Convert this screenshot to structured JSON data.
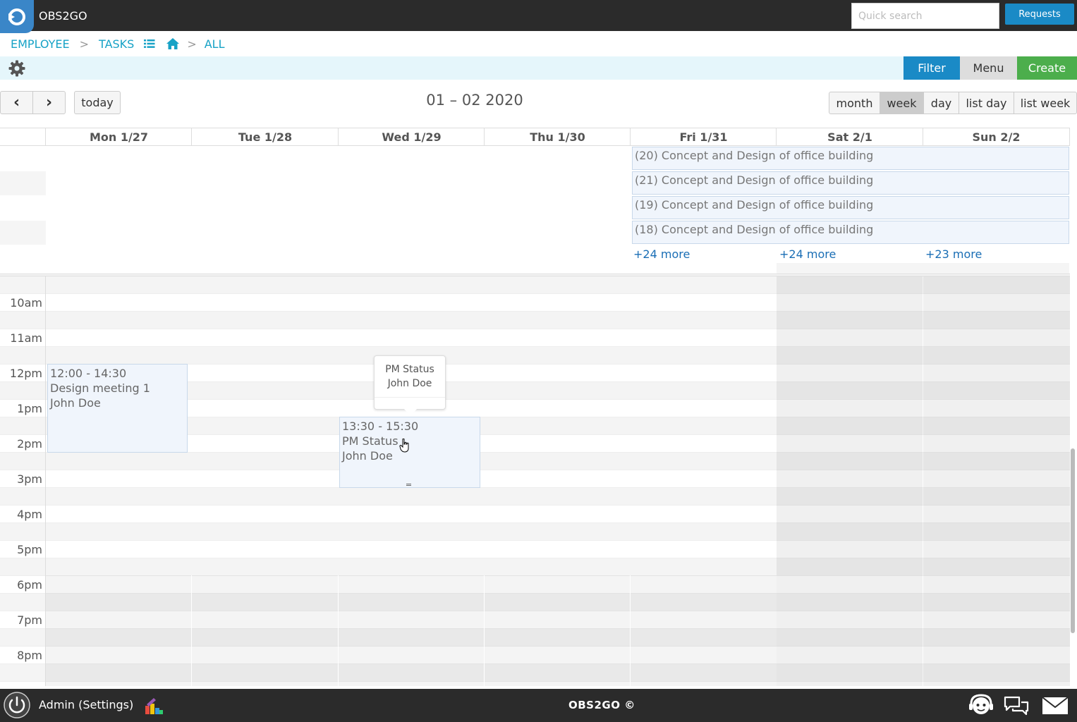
{
  "app": {
    "title": "OBS2GO"
  },
  "search": {
    "placeholder": "Quick search"
  },
  "header": {
    "requests_label": "Requests"
  },
  "breadcrumb": {
    "employee": "EMPLOYEE",
    "sep": ">",
    "tasks": "TASKS",
    "all": "ALL"
  },
  "toolbar": {
    "filter_label": "Filter",
    "menu_label": "Menu",
    "create_label": "Create"
  },
  "calendar": {
    "prev_label": "‹",
    "next_label": "›",
    "today_label": "today",
    "title": "01 – 02 2020",
    "views": [
      "month",
      "week",
      "day",
      "list day",
      "list week"
    ],
    "active_view": "week",
    "days": [
      "Mon 1/27",
      "Tue 1/28",
      "Wed 1/29",
      "Thu 1/30",
      "Fri 1/31",
      "Sat 2/1",
      "Sun 2/2"
    ],
    "allday_events": [
      "(20) Concept and Design of office building",
      "(21) Concept and Design of office building",
      "(19) Concept and Design of office building",
      "(18) Concept and Design of office building"
    ],
    "more_links": [
      "+24 more",
      "+24 more",
      "+23 more"
    ],
    "time_labels": [
      "10am",
      "11am",
      "12pm",
      "1pm",
      "2pm",
      "3pm",
      "4pm",
      "5pm",
      "6pm",
      "7pm",
      "8pm"
    ],
    "events": [
      {
        "time": "12:00 - 14:30",
        "title": "Design meeting 1",
        "person": "John Doe"
      },
      {
        "time": "13:30 - 15:30",
        "title": "PM Status",
        "person": "John Doe"
      }
    ],
    "popover": {
      "title": "PM Status",
      "person": "John Doe"
    }
  },
  "footer": {
    "user_label": "Admin (Settings)",
    "brand": "OBS2GO ©"
  },
  "colors": {
    "accent": "#1a8ac6",
    "create": "#4cae4c",
    "link": "#17a2c6",
    "dark_bar": "#2b2b2b"
  }
}
